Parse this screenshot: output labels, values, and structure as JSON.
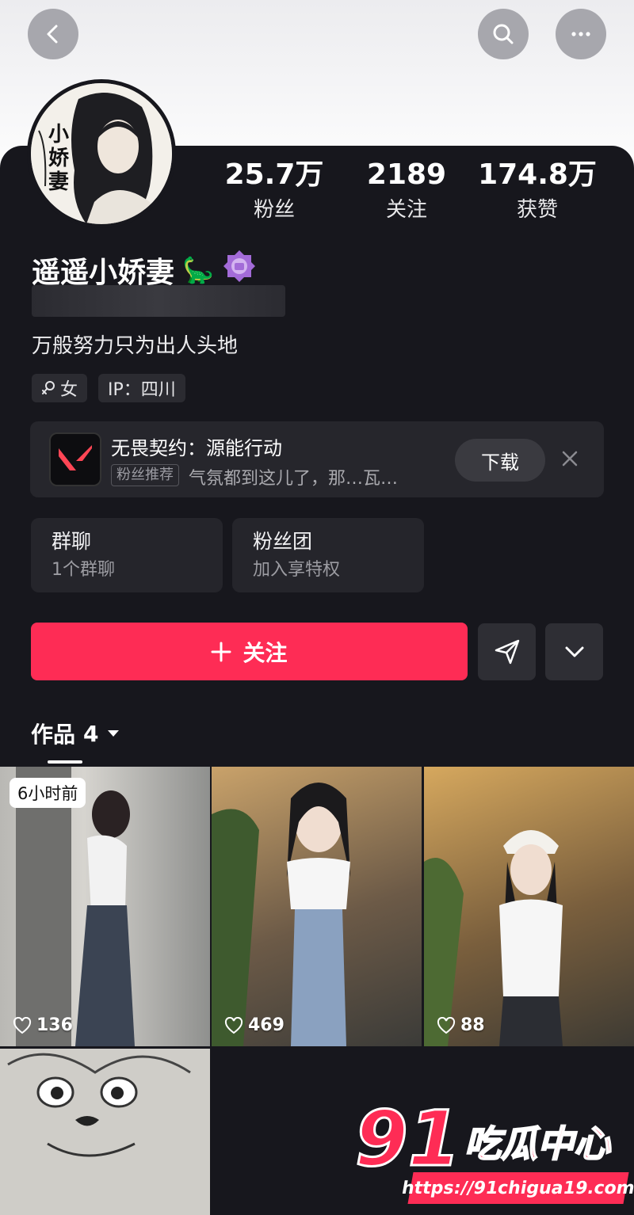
{
  "nav": {
    "back_icon": "chevron-left-icon",
    "search_icon": "search-icon",
    "more_icon": "ellipsis-icon"
  },
  "profile": {
    "name": "遥遥小娇妻",
    "name_emoji": "🦕",
    "avatar_calligraphy": "小娇妻",
    "bio": "万般努力只为出人头地",
    "tags": {
      "gender": "女",
      "ip": "IP：四川"
    }
  },
  "stats": [
    {
      "value": "25.7万",
      "label": "粉丝"
    },
    {
      "value": "2189",
      "label": "关注"
    },
    {
      "value": "174.8万",
      "label": "获赞"
    }
  ],
  "promo": {
    "title": "无畏契约：源能行动",
    "badge": "粉丝推荐",
    "desc": "气氛都到这儿了，那…瓦…",
    "download_label": "下载"
  },
  "cards": {
    "group": {
      "title": "群聊",
      "sub": "1个群聊"
    },
    "fan": {
      "title": "粉丝团",
      "sub": "加入享特权"
    }
  },
  "actions": {
    "follow_label": "关注",
    "follow_icon": "plus-icon",
    "share_icon": "send-icon",
    "dropdown_icon": "chevron-down-icon"
  },
  "works": {
    "tab_label": "作品",
    "count": "4",
    "items": [
      {
        "likes": "136",
        "badge": "6小时前"
      },
      {
        "likes": "469"
      },
      {
        "likes": "88"
      },
      {
        "likes": ""
      }
    ]
  },
  "watermark": {
    "number": "91",
    "text": "吃瓜中心",
    "url": "https://91chigua19.com"
  }
}
